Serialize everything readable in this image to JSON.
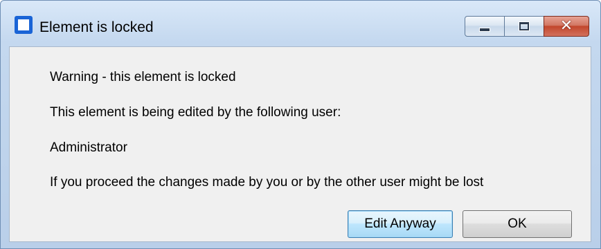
{
  "window": {
    "title": "Element is locked"
  },
  "message": {
    "warning": "Warning - this element is locked",
    "edited_by": "This element is being edited by the following user:",
    "user": "Administrator",
    "consequence": "If you proceed the changes made by you or by the other user might be lost"
  },
  "buttons": {
    "edit_anyway": "Edit Anyway",
    "ok": "OK"
  },
  "colors": {
    "frame": "#c4d8ef",
    "client_background": "#f0f0f0",
    "close_button": "#c2462c",
    "app_icon": "#1a64d6"
  },
  "icons": {
    "app": "app-icon",
    "minimize": "minimize-icon",
    "maximize": "maximize-icon",
    "close": "close-icon"
  }
}
